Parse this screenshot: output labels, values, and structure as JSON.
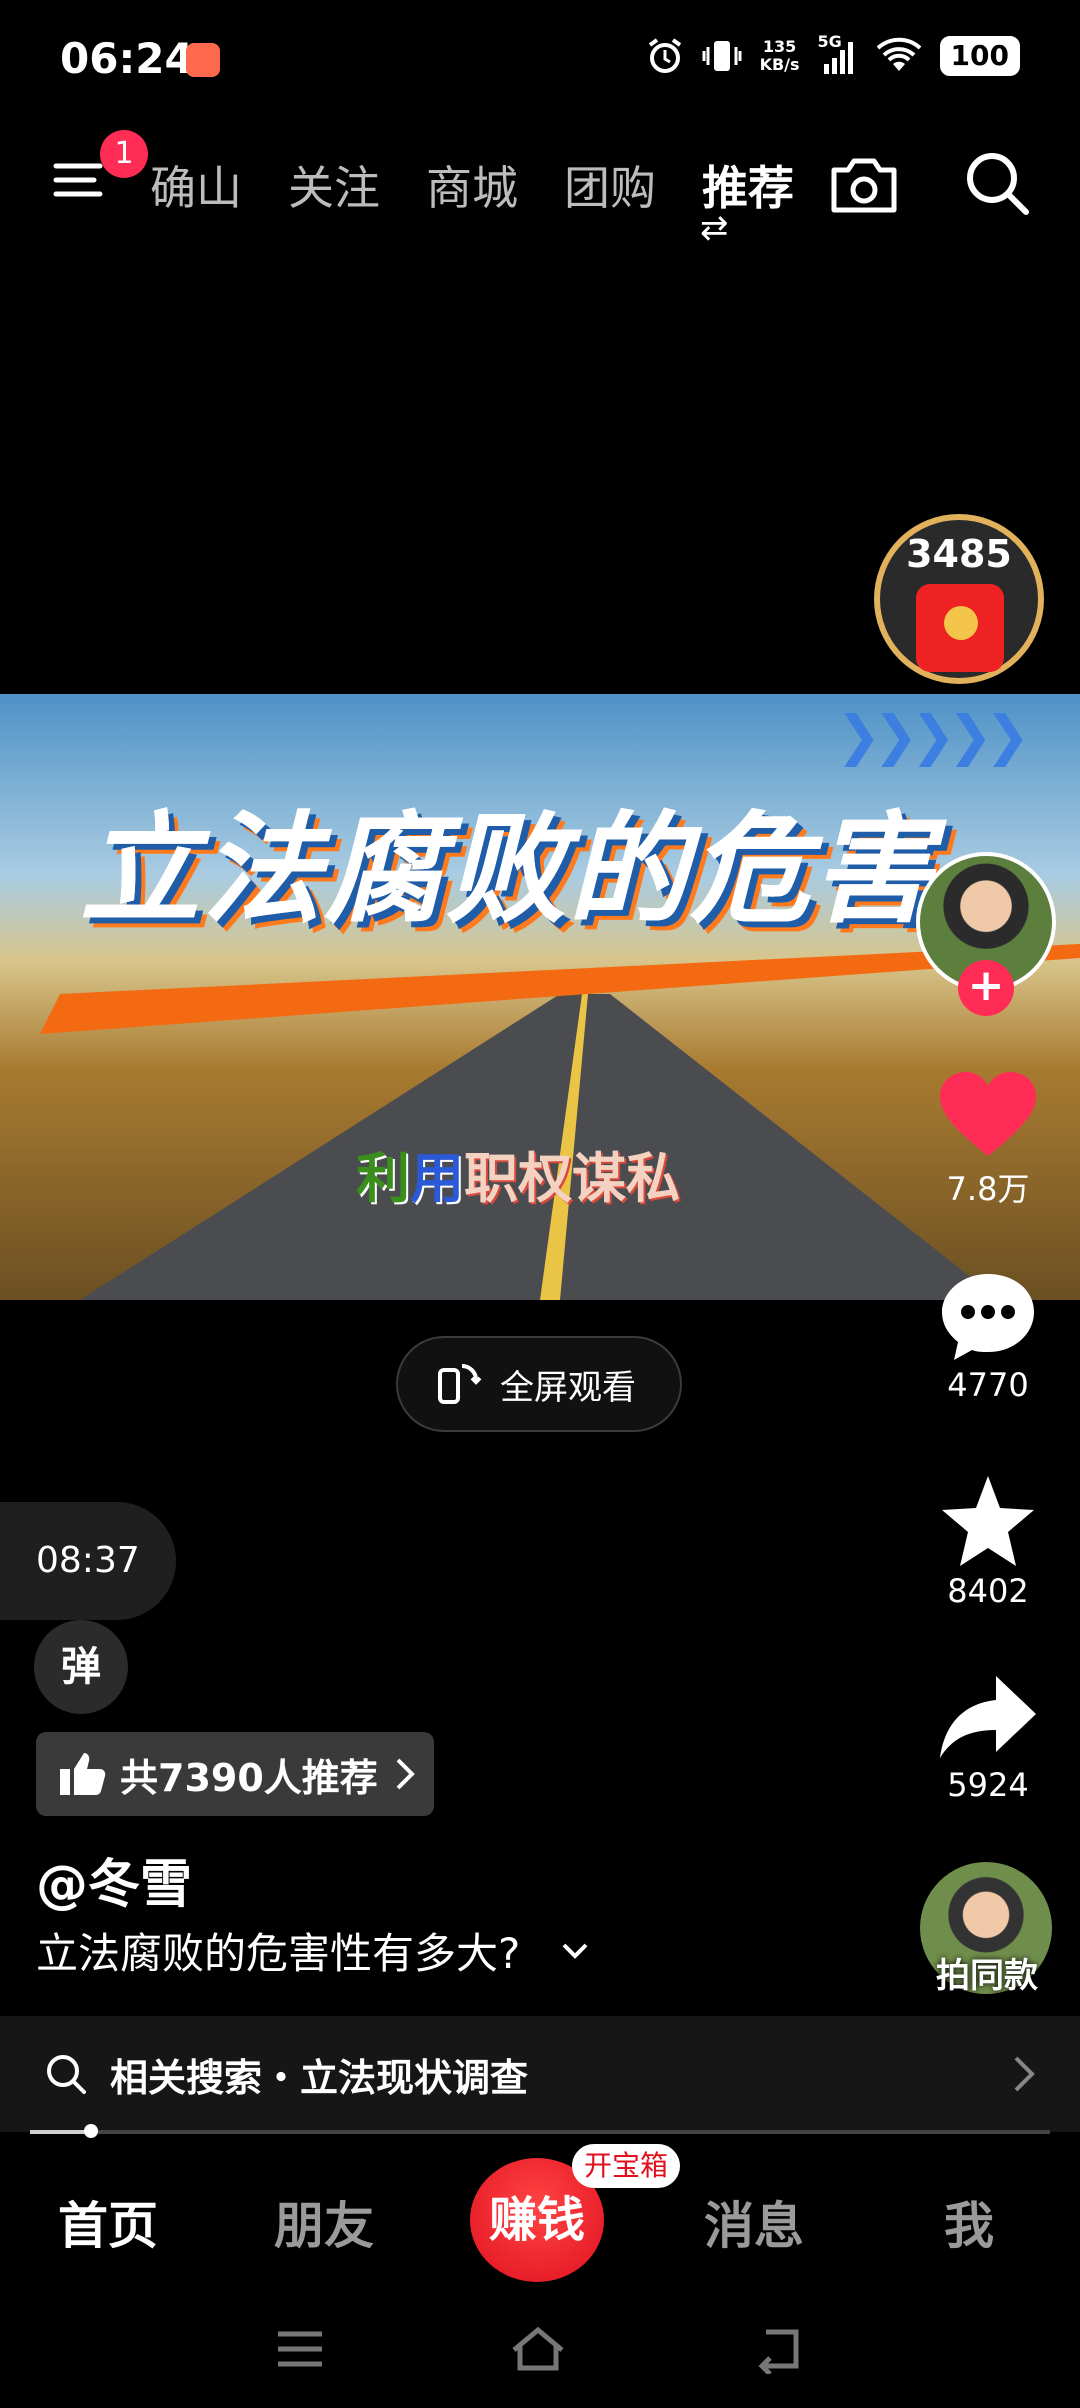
{
  "status_bar": {
    "time": "06:24",
    "net_speed_value": "135",
    "net_speed_unit": "KB/s",
    "network": "5G",
    "battery": "100"
  },
  "top_nav": {
    "menu_badge": "1",
    "tabs": [
      {
        "label": "确山",
        "active": false
      },
      {
        "label": "关注",
        "active": false
      },
      {
        "label": "商城",
        "active": false
      },
      {
        "label": "团购",
        "active": false
      },
      {
        "label": "推荐",
        "active": true
      }
    ]
  },
  "red_packet": {
    "count": "3485"
  },
  "video": {
    "title": "立法腐败的危害",
    "subtitle_parts": [
      "利",
      "用",
      "职权谋私"
    ]
  },
  "fullscreen_label": "全屏观看",
  "rail": {
    "likes": "7.8万",
    "comments": "4770",
    "favorites": "8402",
    "shares": "5924",
    "same_style_label": "拍同款"
  },
  "timer": "08:37",
  "danmaku_label": "弹",
  "recommend_label": "共7390人推荐",
  "author": "@冬雪",
  "caption": "立法腐败的危害性有多大?",
  "related_search": "相关搜索・立法现状调查",
  "progress": 0.06,
  "bottom_tabs": {
    "home": "首页",
    "friends": "朋友",
    "earn": "赚钱",
    "treasure": "开宝箱",
    "messages": "消息",
    "me": "我"
  },
  "colors": {
    "accent": "#ff2c55",
    "earn": "#e0101e"
  }
}
